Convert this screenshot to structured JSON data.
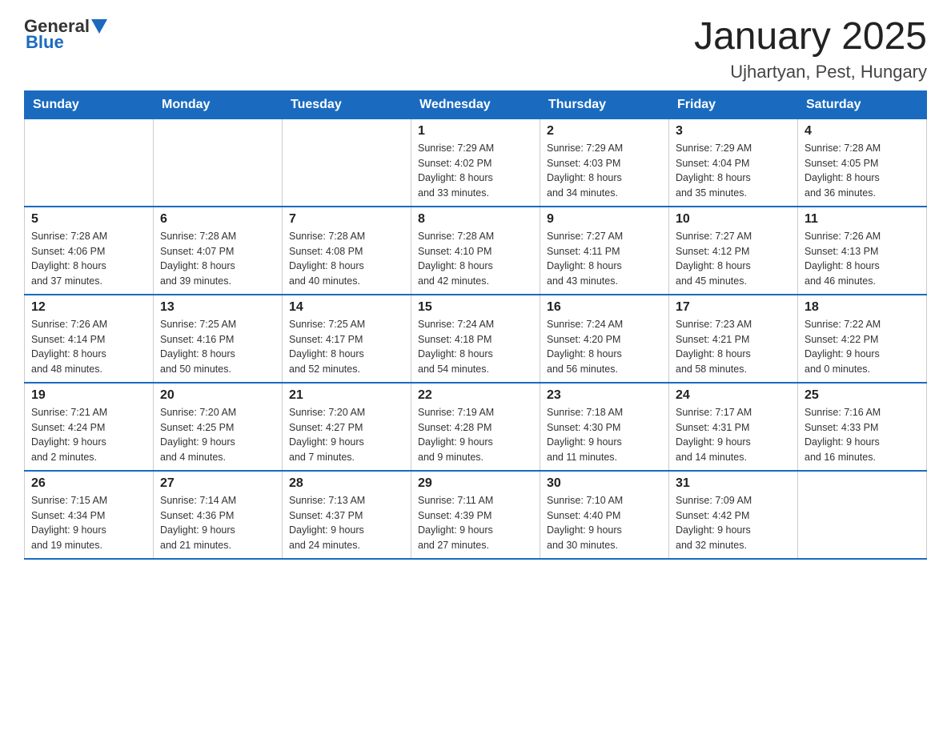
{
  "header": {
    "logo_general": "General",
    "logo_blue": "Blue",
    "title": "January 2025",
    "subtitle": "Ujhartyan, Pest, Hungary"
  },
  "days_of_week": [
    "Sunday",
    "Monday",
    "Tuesday",
    "Wednesday",
    "Thursday",
    "Friday",
    "Saturday"
  ],
  "weeks": [
    [
      {
        "day": "",
        "info": ""
      },
      {
        "day": "",
        "info": ""
      },
      {
        "day": "",
        "info": ""
      },
      {
        "day": "1",
        "info": "Sunrise: 7:29 AM\nSunset: 4:02 PM\nDaylight: 8 hours\nand 33 minutes."
      },
      {
        "day": "2",
        "info": "Sunrise: 7:29 AM\nSunset: 4:03 PM\nDaylight: 8 hours\nand 34 minutes."
      },
      {
        "day": "3",
        "info": "Sunrise: 7:29 AM\nSunset: 4:04 PM\nDaylight: 8 hours\nand 35 minutes."
      },
      {
        "day": "4",
        "info": "Sunrise: 7:28 AM\nSunset: 4:05 PM\nDaylight: 8 hours\nand 36 minutes."
      }
    ],
    [
      {
        "day": "5",
        "info": "Sunrise: 7:28 AM\nSunset: 4:06 PM\nDaylight: 8 hours\nand 37 minutes."
      },
      {
        "day": "6",
        "info": "Sunrise: 7:28 AM\nSunset: 4:07 PM\nDaylight: 8 hours\nand 39 minutes."
      },
      {
        "day": "7",
        "info": "Sunrise: 7:28 AM\nSunset: 4:08 PM\nDaylight: 8 hours\nand 40 minutes."
      },
      {
        "day": "8",
        "info": "Sunrise: 7:28 AM\nSunset: 4:10 PM\nDaylight: 8 hours\nand 42 minutes."
      },
      {
        "day": "9",
        "info": "Sunrise: 7:27 AM\nSunset: 4:11 PM\nDaylight: 8 hours\nand 43 minutes."
      },
      {
        "day": "10",
        "info": "Sunrise: 7:27 AM\nSunset: 4:12 PM\nDaylight: 8 hours\nand 45 minutes."
      },
      {
        "day": "11",
        "info": "Sunrise: 7:26 AM\nSunset: 4:13 PM\nDaylight: 8 hours\nand 46 minutes."
      }
    ],
    [
      {
        "day": "12",
        "info": "Sunrise: 7:26 AM\nSunset: 4:14 PM\nDaylight: 8 hours\nand 48 minutes."
      },
      {
        "day": "13",
        "info": "Sunrise: 7:25 AM\nSunset: 4:16 PM\nDaylight: 8 hours\nand 50 minutes."
      },
      {
        "day": "14",
        "info": "Sunrise: 7:25 AM\nSunset: 4:17 PM\nDaylight: 8 hours\nand 52 minutes."
      },
      {
        "day": "15",
        "info": "Sunrise: 7:24 AM\nSunset: 4:18 PM\nDaylight: 8 hours\nand 54 minutes."
      },
      {
        "day": "16",
        "info": "Sunrise: 7:24 AM\nSunset: 4:20 PM\nDaylight: 8 hours\nand 56 minutes."
      },
      {
        "day": "17",
        "info": "Sunrise: 7:23 AM\nSunset: 4:21 PM\nDaylight: 8 hours\nand 58 minutes."
      },
      {
        "day": "18",
        "info": "Sunrise: 7:22 AM\nSunset: 4:22 PM\nDaylight: 9 hours\nand 0 minutes."
      }
    ],
    [
      {
        "day": "19",
        "info": "Sunrise: 7:21 AM\nSunset: 4:24 PM\nDaylight: 9 hours\nand 2 minutes."
      },
      {
        "day": "20",
        "info": "Sunrise: 7:20 AM\nSunset: 4:25 PM\nDaylight: 9 hours\nand 4 minutes."
      },
      {
        "day": "21",
        "info": "Sunrise: 7:20 AM\nSunset: 4:27 PM\nDaylight: 9 hours\nand 7 minutes."
      },
      {
        "day": "22",
        "info": "Sunrise: 7:19 AM\nSunset: 4:28 PM\nDaylight: 9 hours\nand 9 minutes."
      },
      {
        "day": "23",
        "info": "Sunrise: 7:18 AM\nSunset: 4:30 PM\nDaylight: 9 hours\nand 11 minutes."
      },
      {
        "day": "24",
        "info": "Sunrise: 7:17 AM\nSunset: 4:31 PM\nDaylight: 9 hours\nand 14 minutes."
      },
      {
        "day": "25",
        "info": "Sunrise: 7:16 AM\nSunset: 4:33 PM\nDaylight: 9 hours\nand 16 minutes."
      }
    ],
    [
      {
        "day": "26",
        "info": "Sunrise: 7:15 AM\nSunset: 4:34 PM\nDaylight: 9 hours\nand 19 minutes."
      },
      {
        "day": "27",
        "info": "Sunrise: 7:14 AM\nSunset: 4:36 PM\nDaylight: 9 hours\nand 21 minutes."
      },
      {
        "day": "28",
        "info": "Sunrise: 7:13 AM\nSunset: 4:37 PM\nDaylight: 9 hours\nand 24 minutes."
      },
      {
        "day": "29",
        "info": "Sunrise: 7:11 AM\nSunset: 4:39 PM\nDaylight: 9 hours\nand 27 minutes."
      },
      {
        "day": "30",
        "info": "Sunrise: 7:10 AM\nSunset: 4:40 PM\nDaylight: 9 hours\nand 30 minutes."
      },
      {
        "day": "31",
        "info": "Sunrise: 7:09 AM\nSunset: 4:42 PM\nDaylight: 9 hours\nand 32 minutes."
      },
      {
        "day": "",
        "info": ""
      }
    ]
  ]
}
